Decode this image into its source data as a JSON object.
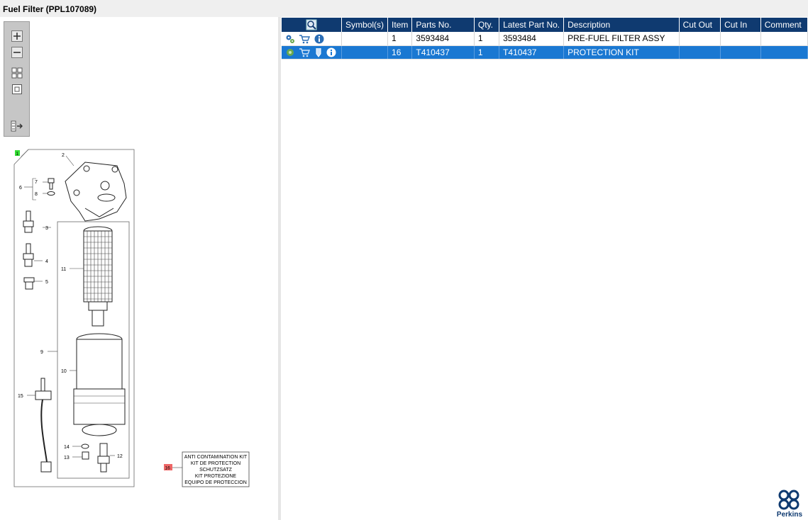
{
  "window": {
    "title": "Fuel Filter (PPL107089)"
  },
  "toolbar": {
    "buttons": [
      "zoom-in-icon",
      "zoom-out-icon",
      "fit-all-icon",
      "fit-selection-icon",
      "expand-list-icon"
    ]
  },
  "diagram": {
    "marker_1": "1",
    "callouts": {
      "c2": "2",
      "c3": "3",
      "c4": "4",
      "c5": "5",
      "c6": "6",
      "c7": "7",
      "c8": "8",
      "c9": "9",
      "c10": "10",
      "c11": "11",
      "c12": "12",
      "c13": "13",
      "c14": "14",
      "c15": "15"
    },
    "kit_marker": "16",
    "kit_label": [
      "ANTI CONTAMINATION KIT",
      "KIT DE PROTECTION",
      "SCHUTZSATZ",
      "KIT PROTEZIONE",
      "EQUIPO DE PROTECCION"
    ]
  },
  "table": {
    "headers": {
      "icons": "",
      "symbols": "Symbol(s)",
      "item": "Item",
      "parts_no": "Parts No.",
      "qty": "Qty.",
      "latest": "Latest Part No.",
      "description": "Description",
      "cut_out": "Cut Out",
      "cut_in": "Cut In",
      "comment": "Comment"
    },
    "rows": [
      {
        "symbols": "",
        "item": "1",
        "parts_no": "3593484",
        "qty": "1",
        "latest": "3593484",
        "description": "PRE-FUEL FILTER ASSY",
        "cut_out": "",
        "cut_in": "",
        "comment": ""
      },
      {
        "symbols": "",
        "item": "16",
        "parts_no": "T410437",
        "qty": "1",
        "latest": "T410437",
        "description": "PROTECTION KIT",
        "cut_out": "",
        "cut_in": "",
        "comment": ""
      }
    ]
  },
  "brand": {
    "name": "Perkins"
  },
  "colors": {
    "header": "#0f3a70",
    "selected_row": "#1a78d2",
    "marker_green": "#33dd33",
    "marker_red": "#ee6666"
  }
}
